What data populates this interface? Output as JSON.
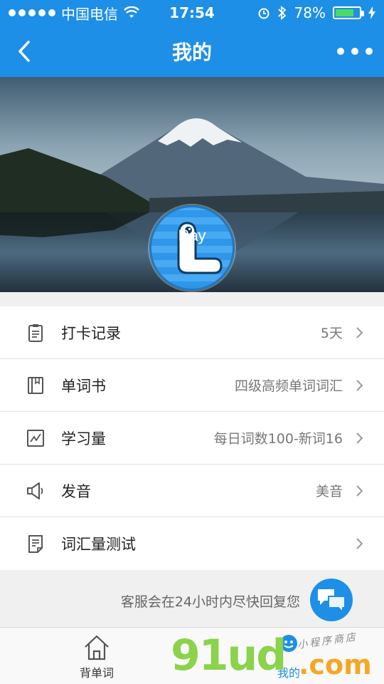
{
  "status_bar": {
    "carrier": "中国电信",
    "time": "17:54",
    "battery": "78%",
    "battery_level": 0.78
  },
  "nav": {
    "title": "我的"
  },
  "profile": {
    "username": "Ray"
  },
  "menu": [
    {
      "label": "打卡记录",
      "value": "5天",
      "icon": "clipboard-icon"
    },
    {
      "label": "单词书",
      "value": "四级高频单词词汇",
      "icon": "book-icon"
    },
    {
      "label": "学习量",
      "value": "每日词数100-新词16",
      "icon": "chart-icon"
    },
    {
      "label": "发音",
      "value": "美音",
      "icon": "speaker-icon"
    },
    {
      "label": "词汇量测试",
      "value": "",
      "icon": "test-document-icon"
    }
  ],
  "support": {
    "message": "客服会在24小时内尽快回复您"
  },
  "tabbar": {
    "tabs": [
      {
        "label": "背单词",
        "icon": "home-icon"
      },
      {
        "label": "我的",
        "icon": "profile-icon"
      }
    ]
  },
  "watermark": {
    "brand": "91ud",
    "domain": ".com",
    "tagline": "小程序商店"
  },
  "colors": {
    "primary": "#1e8fe6",
    "battery_green": "#4cd964",
    "watermark_green": "#8ad34a",
    "watermark_orange": "#f6a623"
  }
}
